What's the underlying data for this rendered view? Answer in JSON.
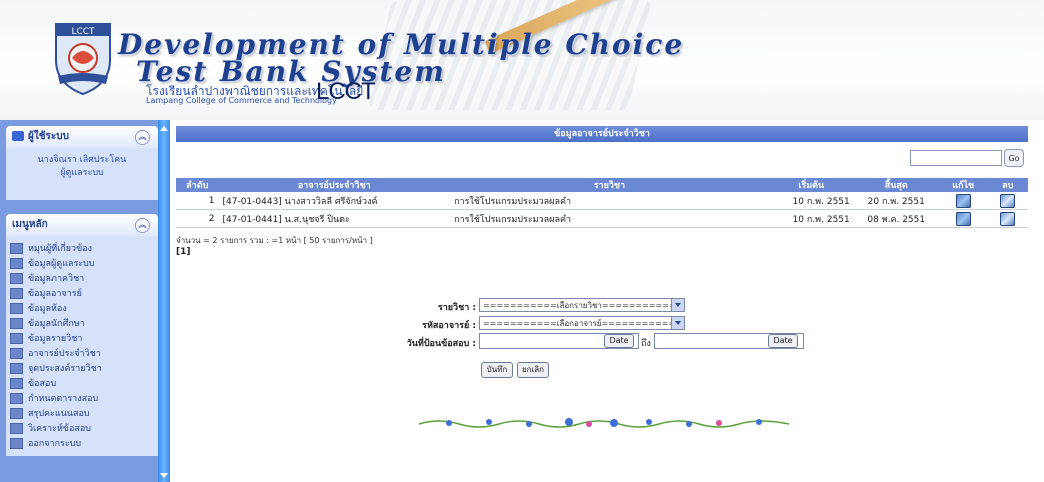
{
  "header": {
    "logo_text": "LCCT",
    "title_line1": "Development of Multiple Choice",
    "title_line2": "Test Bank System",
    "school_thai": "โรงเรียนลำปางพาณิชยการและเทคโนโลยี",
    "school_english": "Lampang College of Commerce and Technology",
    "brand": "LCCT"
  },
  "sidebar": {
    "user_box": {
      "title": "ผู้ใช้ระบบ",
      "user_name": "นางจิณรา เลิศประโคน",
      "role": "ผู้ดูแลระบบ"
    },
    "menu_box": {
      "title": "เมนูหลัก",
      "items": [
        {
          "label": "หมุนผู้ที่เกี่ยวข้อง"
        },
        {
          "label": "ข้อมูลผู้ดูแลระบบ"
        },
        {
          "label": "ข้อมูลภาควิชา"
        },
        {
          "label": "ข้อมูลอาจารย์"
        },
        {
          "label": "ข้อมูลห้อง"
        },
        {
          "label": "ข้อมูลนักศึกษา"
        },
        {
          "label": "ข้อมูลรายวิชา"
        },
        {
          "label": "อาจารย์ประจำวิชา"
        },
        {
          "label": "จุดประสงค์รายวิชา"
        },
        {
          "label": "ข้อสอบ"
        },
        {
          "label": "กำหนดตารางสอบ"
        },
        {
          "label": "สรุปคะแนนสอบ"
        },
        {
          "label": "วิเคราะห์ข้อสอบ"
        },
        {
          "label": "ออกจากระบบ"
        }
      ]
    }
  },
  "content": {
    "title": "ข้อมูลอาจารย์ประจำวิชา",
    "search": {
      "value": "",
      "go_label": "Go"
    },
    "table": {
      "columns": [
        "ลำดับ",
        "อาจารย์ประจำวิชา",
        "รายวิชา",
        "เริ่มต้น",
        "สิ้นสุด",
        "แก้ไข",
        "ลบ"
      ],
      "rows": [
        {
          "no": "1",
          "teacher": "[47-01-0443] นางสาววิลลี ศรีจักษ์วงค์",
          "subject": "การใช้โปรแกรมประมวลผลคำ",
          "start": "10 ก.พ. 2551",
          "end": "20 ก.พ. 2551"
        },
        {
          "no": "2",
          "teacher": "[47-01-0441] น.ส.นุชจรี ปินตะ",
          "subject": "การใช้โปรแกรมประมวลผลคำ",
          "start": "10 ก.พ. 2551",
          "end": "08 พ.ค. 2551"
        }
      ]
    },
    "summary": "จำนวน = 2 รายการ รวม : =1 หน้า [ 50 รายการ/หน้า ]",
    "pager": "[1]",
    "form": {
      "subject_label": "รายวิชา :",
      "subject_value": "===========เลือกรายวิชา===========",
      "teacher_label": "รหัสอาจารย์ :",
      "teacher_value": "===========เลือกอาจารย์===========",
      "date_label": "วันที่ป้อนข้อสอบ :",
      "date_button": "Date",
      "to_label": "ถึง",
      "save_label": "บันทึก",
      "cancel_label": "ยกเลิก"
    }
  },
  "colors": {
    "sidebar_bg": "#7b9be0",
    "header_bar": "#6a88d4",
    "title_blue": "#1f3f8f"
  }
}
